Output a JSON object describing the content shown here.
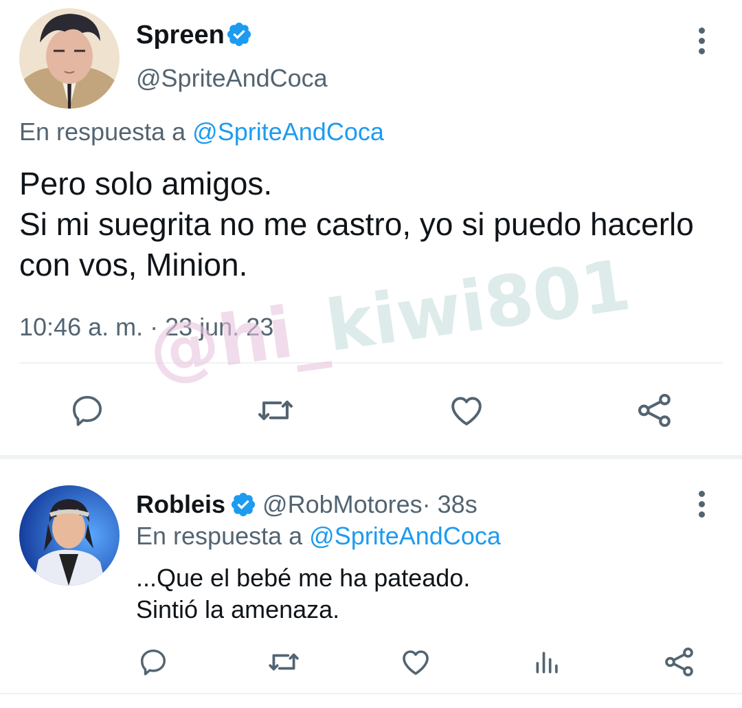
{
  "main_tweet": {
    "author": {
      "display_name": "Spreen",
      "verified": true,
      "handle": "@SpriteAndCoca"
    },
    "reply_to_prefix": "En respuesta a",
    "reply_to_handle": "@SpriteAndCoca",
    "text": "Pero solo amigos.\nSi mi suegrita no me castro, yo si puedo hacerlo con vos, Minion.",
    "timestamp": "10:46 a. m. · 23 jun. 23",
    "actions": [
      {
        "name": "reply",
        "icon": "comment-icon"
      },
      {
        "name": "retweet",
        "icon": "retweet-icon"
      },
      {
        "name": "like",
        "icon": "heart-icon"
      },
      {
        "name": "share",
        "icon": "share-icon"
      }
    ]
  },
  "reply_tweet": {
    "author": {
      "display_name": "Robleis",
      "verified": true,
      "handle": "@RobMotores",
      "time_ago": " · 38s"
    },
    "reply_to_prefix": "En respuesta a",
    "reply_to_handle": "@SpriteAndCoca",
    "text": "...Que el bebé me ha pateado.\nSintió la amenaza.",
    "actions": [
      {
        "name": "reply",
        "icon": "comment-icon"
      },
      {
        "name": "retweet",
        "icon": "retweet-icon"
      },
      {
        "name": "like",
        "icon": "heart-icon"
      },
      {
        "name": "views",
        "icon": "bar-chart-icon"
      },
      {
        "name": "share",
        "icon": "share-icon"
      }
    ]
  },
  "watermark": {
    "part_a": "@hi_",
    "part_b": "kiwi801"
  },
  "colors": {
    "text": "#0f1419",
    "secondary": "#536471",
    "link": "#1d9bf0",
    "verified": "#1d9bf0",
    "divider": "#eff3f4"
  }
}
